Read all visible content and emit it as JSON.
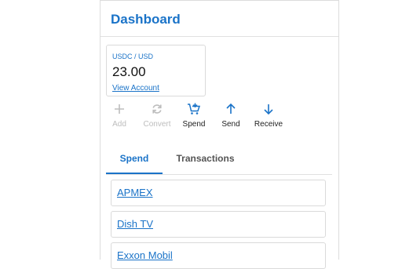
{
  "header": {
    "title": "Dashboard"
  },
  "balance": {
    "pair": "USDC / USD",
    "amount": "23.00",
    "view_account": "View Account"
  },
  "actions": [
    {
      "label": "Add",
      "icon": "plus-icon",
      "enabled": false
    },
    {
      "label": "Convert",
      "icon": "refresh-icon",
      "enabled": false
    },
    {
      "label": "Spend",
      "icon": "cart-plus-icon",
      "enabled": true
    },
    {
      "label": "Send",
      "icon": "arrow-up-icon",
      "enabled": true
    },
    {
      "label": "Receive",
      "icon": "arrow-down-icon",
      "enabled": true
    }
  ],
  "tabs": [
    {
      "label": "Spend",
      "active": true
    },
    {
      "label": "Transactions",
      "active": false
    }
  ],
  "merchants": [
    "APMEX",
    "Dish TV",
    "Exxon Mobil"
  ],
  "colors": {
    "accent": "#1a73c8",
    "disabled": "#bdbdbd",
    "border": "#dadada"
  }
}
